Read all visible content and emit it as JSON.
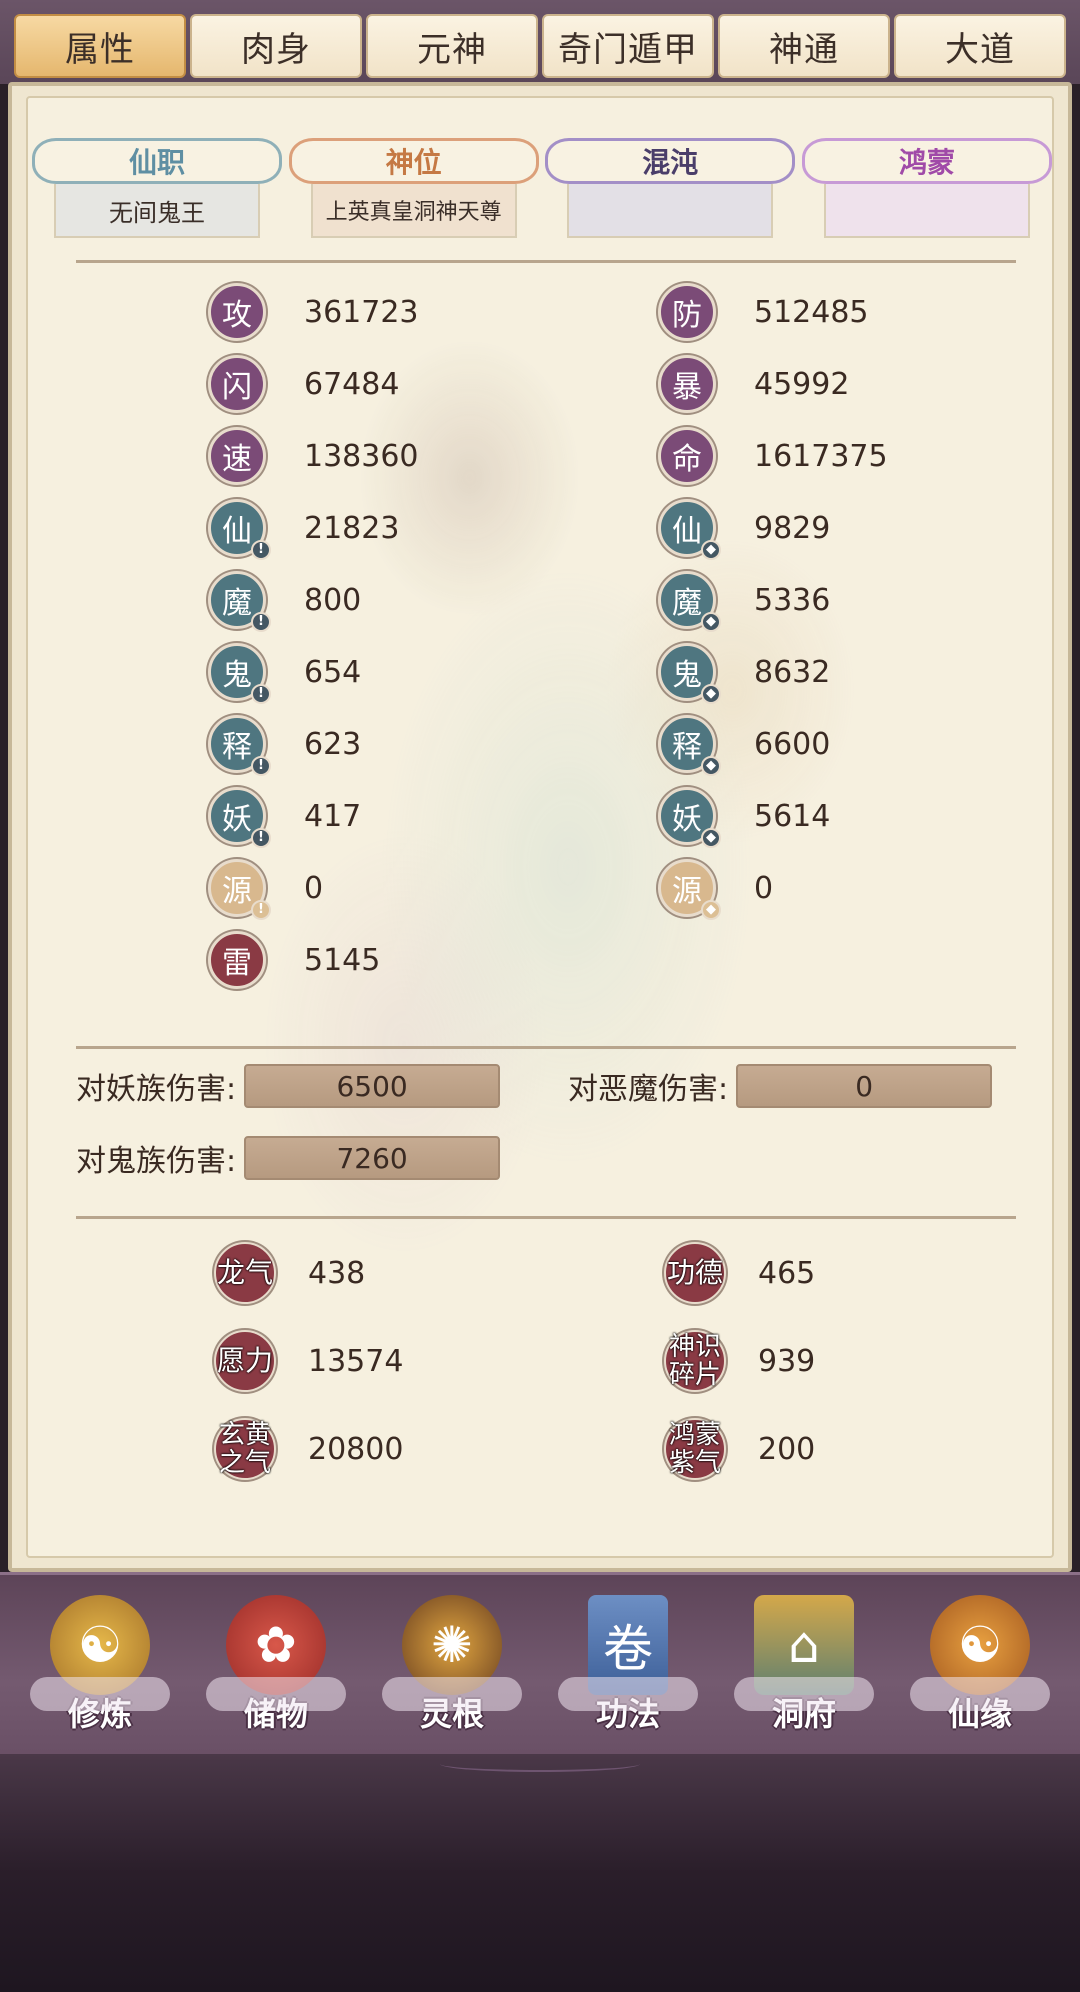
{
  "tabs": [
    {
      "label": "属性",
      "active": true
    },
    {
      "label": "肉身",
      "active": false
    },
    {
      "label": "元神",
      "active": false
    },
    {
      "label": "奇门遁甲",
      "active": false
    },
    {
      "label": "神通",
      "active": false
    },
    {
      "label": "大道",
      "active": false
    }
  ],
  "ranks": [
    {
      "title": "仙职",
      "value": "无间鬼王"
    },
    {
      "title": "神位",
      "value": "上英真皇洞神天尊"
    },
    {
      "title": "混沌",
      "value": ""
    },
    {
      "title": "鸿蒙",
      "value": ""
    }
  ],
  "stats_left": [
    {
      "glyph": "攻",
      "value": "361723"
    },
    {
      "glyph": "闪",
      "value": "67484"
    },
    {
      "glyph": "速",
      "value": "138360"
    },
    {
      "glyph": "仙",
      "value": "21823"
    },
    {
      "glyph": "魔",
      "value": "800"
    },
    {
      "glyph": "鬼",
      "value": "654"
    },
    {
      "glyph": "释",
      "value": "623"
    },
    {
      "glyph": "妖",
      "value": "417"
    },
    {
      "glyph": "源",
      "value": "0"
    },
    {
      "glyph": "雷",
      "value": "5145"
    }
  ],
  "stats_right": [
    {
      "glyph": "防",
      "value": "512485"
    },
    {
      "glyph": "暴",
      "value": "45992"
    },
    {
      "glyph": "命",
      "value": "1617375"
    },
    {
      "glyph": "仙",
      "value": "9829"
    },
    {
      "glyph": "魔",
      "value": "5336"
    },
    {
      "glyph": "鬼",
      "value": "8632"
    },
    {
      "glyph": "释",
      "value": "6600"
    },
    {
      "glyph": "妖",
      "value": "5614"
    },
    {
      "glyph": "源",
      "value": "0"
    }
  ],
  "damage": {
    "yao_label": "对妖族伤害:",
    "yao_value": "6500",
    "demon_label": "对恶魔伤害:",
    "demon_value": "0",
    "ghost_label": "对鬼族伤害:",
    "ghost_value": "7260"
  },
  "resources": {
    "longqi": {
      "label": "龙气",
      "value": "438"
    },
    "gongde": {
      "label": "功德",
      "value": "465"
    },
    "yuanli": {
      "label": "愿力",
      "value": "13574"
    },
    "shenshi": {
      "label": "神识碎片",
      "value": "939"
    },
    "xuanhuang": {
      "label": "玄黄之气",
      "value": "20800"
    },
    "hongmeng": {
      "label": "鸿蒙紫气",
      "value": "200"
    }
  },
  "nav": [
    {
      "label": "修炼",
      "icon": "cultivate-icon"
    },
    {
      "label": "储物",
      "icon": "storage-bag-icon"
    },
    {
      "label": "灵根",
      "icon": "spirit-root-icon"
    },
    {
      "label": "功法",
      "icon": "technique-book-icon"
    },
    {
      "label": "洞府",
      "icon": "cave-mansion-icon"
    },
    {
      "label": "仙缘",
      "icon": "immortal-fate-icon"
    }
  ]
}
